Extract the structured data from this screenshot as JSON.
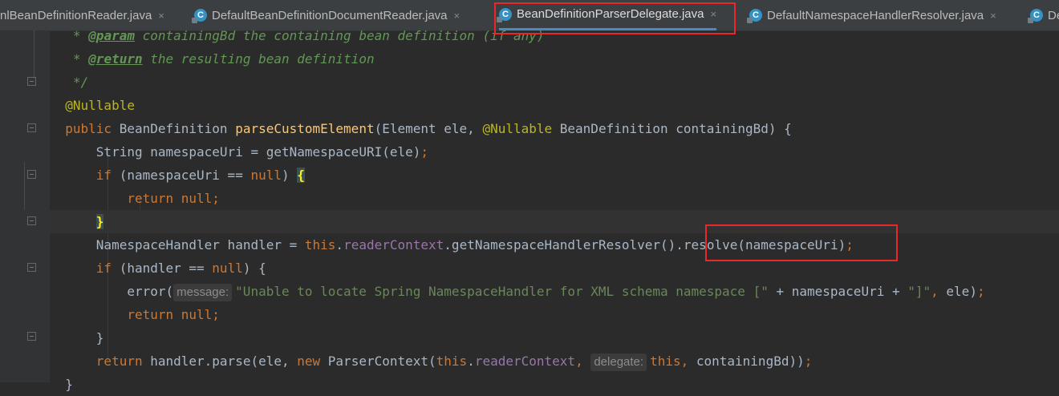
{
  "tabs": [
    {
      "label": "nlBeanDefinitionReader.java",
      "has_icon": false
    },
    {
      "label": "DefaultBeanDefinitionDocumentReader.java",
      "has_icon": true
    },
    {
      "label": "BeanDefinitionParserDelegate.java",
      "has_icon": true,
      "active": true
    },
    {
      "label": "DefaultNamespaceHandlerResolver.java",
      "has_icon": true
    },
    {
      "label": "De",
      "has_icon": true
    }
  ],
  "tab_close_glyph": "×",
  "tab_icon_letter": "C",
  "code": {
    "l1_star": "   * ",
    "l1_tag": "@param",
    "l1_text": " containingBd the containing bean definition (if any)",
    "l2_star": "   * ",
    "l2_tag": "@return",
    "l2_text": " the resulting bean definition",
    "l3": "   */",
    "l4": "  @Nullable",
    "l5_public": "  public",
    "l5_type": " BeanDefinition ",
    "l5_method": "parseCustomElement",
    "l5_a": "(Element ele, ",
    "l5_anno": "@Nullable",
    "l5_b": " BeanDefinition containingBd) {",
    "l6_a": "      String namespaceUri = getNamespaceURI(ele)",
    "l6_semi": ";",
    "l7_if": "      if",
    "l7_a": " (namespaceUri == ",
    "l7_null": "null",
    "l7_b": ") ",
    "l7_brace": "{",
    "l8_return": "          return null",
    "l8_semi": ";",
    "l9_indent": "      ",
    "l9_brace": "}",
    "l10_a": "      NamespaceHandler handler = ",
    "l10_this": "this",
    "l10_dot": ".",
    "l10_field": "readerContext",
    "l10_b": ".getNamespaceHandlerResolver().resolve(namespaceUri)",
    "l10_semi": ";",
    "l11_if": "      if",
    "l11_a": " (handler == ",
    "l11_null": "null",
    "l11_b": ") {",
    "l12_a": "          error(",
    "l12_hint": "message:",
    "l12_str": "\"Unable to locate Spring NamespaceHandler for XML schema namespace [\"",
    "l12_b": " + namespaceUri + ",
    "l12_str2": "\"]\"",
    "l12_comma": ",",
    "l12_c": " ele)",
    "l12_semi": ";",
    "l13_return": "          return null",
    "l13_semi": ";",
    "l14": "      }",
    "l15_return": "      return",
    "l15_a": " handler.parse(ele, ",
    "l15_new": "new",
    "l15_b": " ParserContext(",
    "l15_this": "this",
    "l15_dot": ".",
    "l15_field": "readerContext",
    "l15_comma": ", ",
    "l15_hint": "delegate:",
    "l15_this2": "this",
    "l15_comma2": ",",
    "l15_c": " containingBd))",
    "l15_semi": ";",
    "l16": "  }"
  },
  "colors": {
    "keyword": "#cc7832",
    "annotation": "#bbb529",
    "method": "#ffc66d",
    "field": "#9876aa",
    "string": "#6a8759",
    "highlight_box": "#e8282b"
  }
}
